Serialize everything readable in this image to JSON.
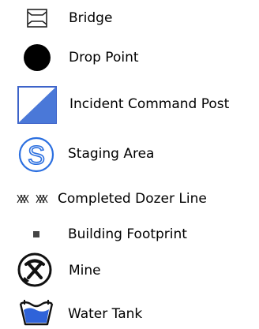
{
  "legend": {
    "items": [
      {
        "label": "Bridge",
        "icon": "bridge-icon"
      },
      {
        "label": "Drop Point",
        "icon": "drop-point-icon"
      },
      {
        "label": "Incident Command Post",
        "icon": "incident-command-post-icon"
      },
      {
        "label": "Staging Area",
        "icon": "staging-area-icon"
      },
      {
        "label": "Completed Dozer Line",
        "icon": "completed-dozer-line-icon"
      },
      {
        "label": "Building Footprint",
        "icon": "building-footprint-icon"
      },
      {
        "label": "Mine",
        "icon": "mine-icon"
      },
      {
        "label": "Water Tank",
        "icon": "water-tank-icon"
      }
    ]
  },
  "colors": {
    "text": "#000000",
    "symbol_blue": "#4a78d8",
    "staging_blue": "#2b6fe0",
    "water_blue": "#2f63d9",
    "icon_black": "#111111",
    "footprint_gray": "#444444"
  }
}
